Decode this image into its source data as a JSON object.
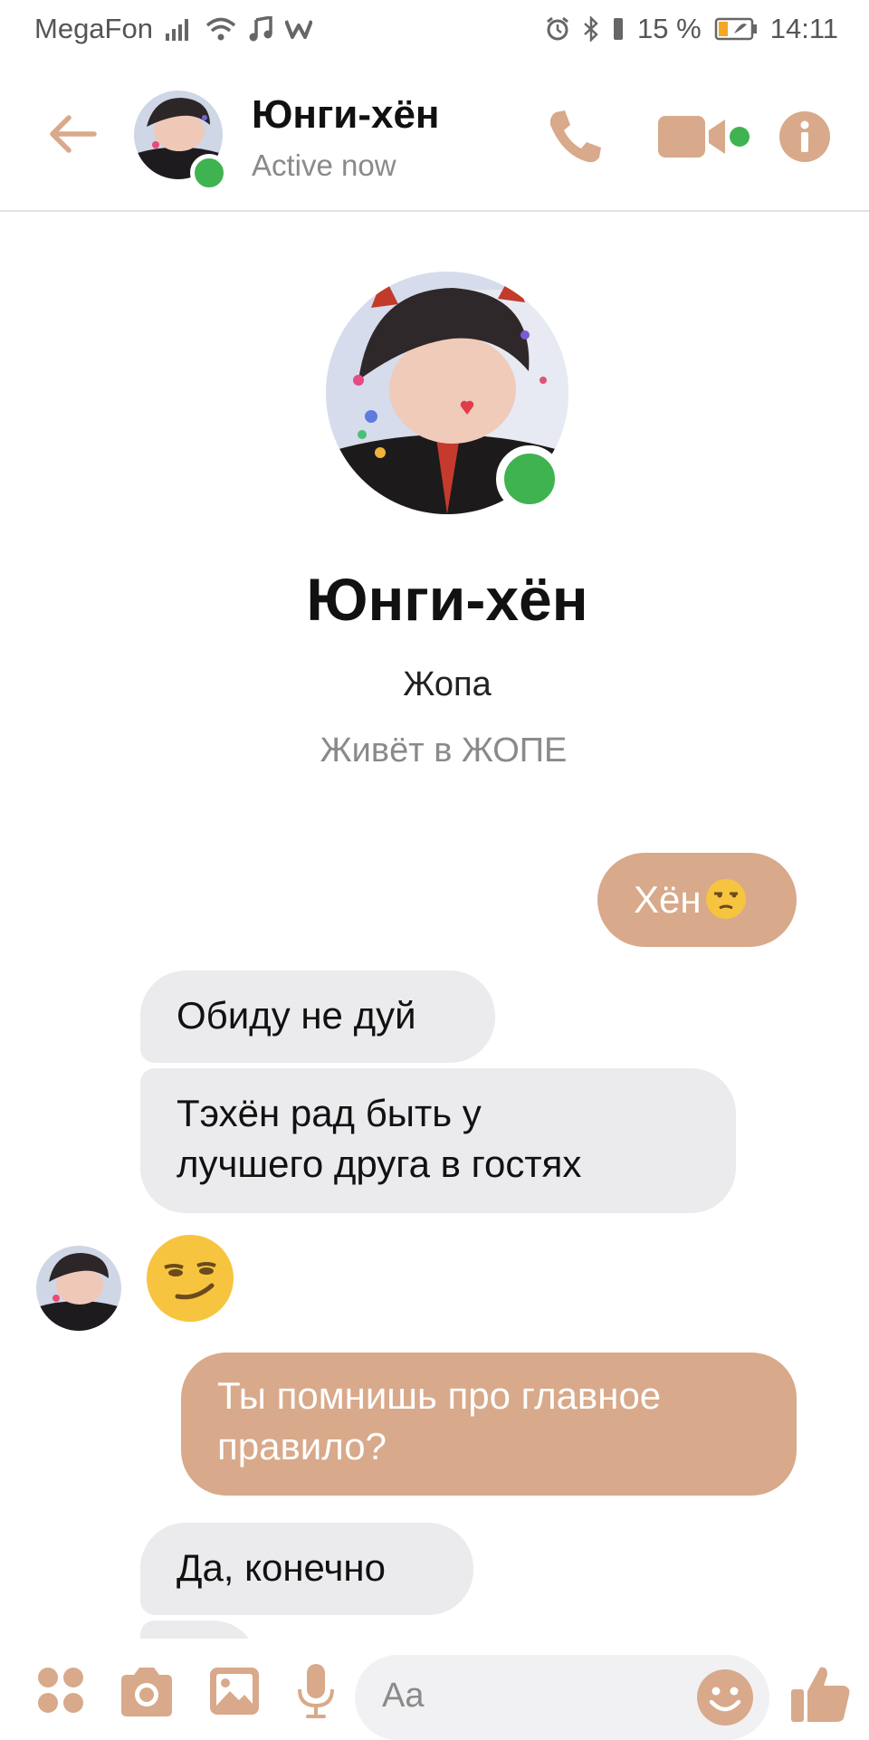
{
  "status_bar": {
    "carrier": "MegaFon",
    "battery_percent": "15 %",
    "time": "14:11"
  },
  "header": {
    "contact_name": "Юнги-хён",
    "presence": "Active now"
  },
  "profile": {
    "name": "Юнги-хён",
    "subtitle": "Жопа",
    "location": "Живёт в ЖОПЕ"
  },
  "messages": [
    {
      "direction": "outgoing",
      "text": "Хён",
      "emoji": "unamused-face"
    },
    {
      "direction": "incoming",
      "text": "Обиду не дуй"
    },
    {
      "direction": "incoming",
      "text_lines": [
        "Тэхён рад быть у",
        "лучшего друга в гостях"
      ]
    },
    {
      "direction": "incoming",
      "emoji": "smirking-face"
    },
    {
      "direction": "outgoing",
      "text_lines": [
        "Ты помнишь про главное",
        "правило?"
      ]
    },
    {
      "direction": "incoming",
      "text": "Да, конечно"
    }
  ],
  "composer": {
    "placeholder": "Aa"
  },
  "colors": {
    "accent": "#d8a98a",
    "online": "#3fb34f",
    "incoming_bubble": "#ebeaed",
    "muted_text": "#8a8a8a"
  },
  "icons": [
    "back-arrow-icon",
    "phone-icon",
    "video-camera-icon",
    "info-icon",
    "apps-icon",
    "camera-icon",
    "gallery-icon",
    "microphone-icon",
    "emoji-icon",
    "thumbs-up-icon"
  ]
}
